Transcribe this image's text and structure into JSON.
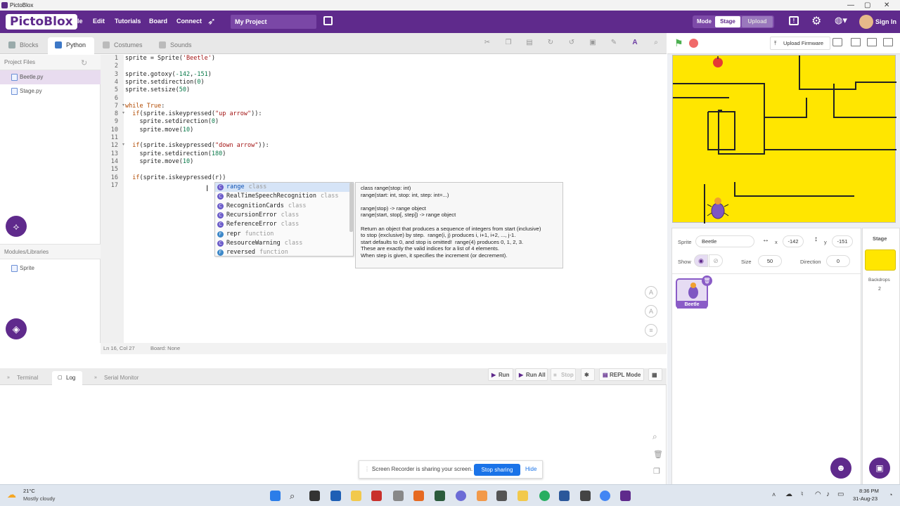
{
  "window": {
    "title": "PictoBlox",
    "controls": [
      "—",
      "▢",
      "✕"
    ]
  },
  "menubar": {
    "logo": "PictoBlox",
    "items": [
      "File",
      "Edit",
      "Tutorials",
      "Board",
      "Connect"
    ],
    "project_name": "My Project",
    "mode_label": "Mode",
    "mode_stage": "Stage",
    "mode_upload": "Upload",
    "sign_in": "Sign In",
    "language_icon": "globe-icon"
  },
  "editor_tabs": {
    "blocks": "Blocks",
    "python": "Python",
    "costumes": "Costumes",
    "sounds": "Sounds"
  },
  "project_files": {
    "header": "Project Files",
    "files": [
      "Beetle.py",
      "Stage.py"
    ],
    "active": "Beetle.py"
  },
  "modules": {
    "header": "Modules/Libraries",
    "items": [
      "Sprite"
    ]
  },
  "code": {
    "line_numbers": [
      "1",
      "2",
      "3",
      "4",
      "5",
      "6",
      "7",
      "8",
      "9",
      "10",
      "11",
      "12",
      "13",
      "14",
      "15",
      "16",
      "17"
    ],
    "lines": [
      "sprite = Sprite('Beetle')",
      "",
      "sprite.gotoxy(-142,-151)",
      "sprite.setdirection(0)",
      "sprite.setsize(50)",
      "",
      "while True:",
      "  if(sprite.iskeypressed(\"up arrow\")):",
      "    sprite.setdirection(0)",
      "    sprite.move(10)",
      "",
      "  if(sprite.iskeypressed(\"down arrow\")):",
      "    sprite.setdirection(180)",
      "    sprite.move(10)",
      "",
      "  if(sprite.iskeypressed(r))",
      ""
    ]
  },
  "autocomplete": {
    "items": [
      {
        "name": "range",
        "kind": "class",
        "badge": "C"
      },
      {
        "name": "RealTimeSpeechRecognition",
        "kind": "class",
        "badge": "C"
      },
      {
        "name": "RecognitionCards",
        "kind": "class",
        "badge": "C"
      },
      {
        "name": "RecursionError",
        "kind": "class",
        "badge": "C"
      },
      {
        "name": "ReferenceError",
        "kind": "class",
        "badge": "C"
      },
      {
        "name": "repr",
        "kind": "function",
        "badge": "F"
      },
      {
        "name": "ResourceWarning",
        "kind": "class",
        "badge": "C"
      },
      {
        "name": "reversed",
        "kind": "function",
        "badge": "F"
      }
    ],
    "doc": [
      "class range(stop: int)",
      "range(start: int, stop: int, step: int=...)",
      "",
      "range(stop) -> range object",
      "range(start, stop[, step]) -> range object",
      "",
      "Return an object that produces a sequence of integers from start (inclusive)",
      "to stop (exclusive) by step.  range(i, j) produces i, i+1, i+2, ..., j-1.",
      "start defaults to 0, and stop is omitted!  range(4) produces 0, 1, 2, 3.",
      "These are exactly the valid indices for a list of 4 elements.",
      "When step is given, it specifies the increment (or decrement)."
    ]
  },
  "status": {
    "position": "Ln 16, Col 27",
    "board": "Board: None"
  },
  "bottom": {
    "tabs": [
      "Terminal",
      "Log",
      "Serial Monitor"
    ],
    "active": "Log",
    "run": "Run",
    "run_all": "Run All",
    "stop": "Stop",
    "repl": "REPL Mode"
  },
  "stage_toolbar": {
    "upload_firmware": "Upload Firmware"
  },
  "sprite_panel": {
    "sprite_label": "Sprite",
    "sprite_name": "Beetle",
    "x_label": "x",
    "x": "-142",
    "y_label": "y",
    "y": "-151",
    "show_label": "Show",
    "size_label": "Size",
    "size": "50",
    "direction_label": "Direction",
    "direction": "0",
    "card_name": "Beetle"
  },
  "stage_column": {
    "title": "Stage",
    "backdrops_label": "Backdrops",
    "backdrops_count": "2"
  },
  "toast": {
    "message": "Screen Recorder is sharing your screen.",
    "stop": "Stop sharing",
    "hide": "Hide"
  },
  "taskbar": {
    "temp": "21°C",
    "weather": "Mostly cloudy",
    "time": "8:36 PM",
    "date": "31-Aug-23"
  },
  "colors": {
    "brand": "#5f2a8c",
    "stage_bg": "#ffe600",
    "accent": "#1a73e8"
  }
}
